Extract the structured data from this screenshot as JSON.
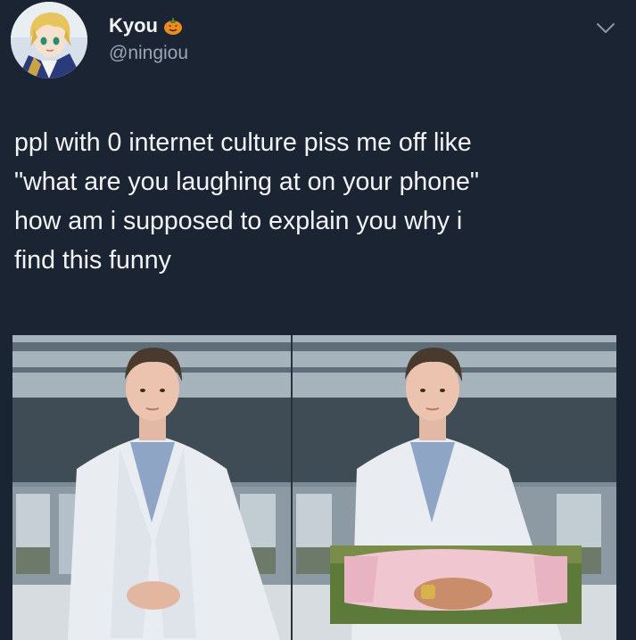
{
  "tweet": {
    "display_name": "Kyou",
    "handle": "@ningiou",
    "text_lines": [
      "ppl with 0 internet culture piss me off like",
      "\"what are you laughing at on your phone\"",
      "how am i supposed to explain you why i",
      "find this funny"
    ]
  },
  "icons": {
    "avatar": "anime-avatar",
    "name_badge": "pumpkin-icon",
    "menu": "chevron-down-icon"
  },
  "colors": {
    "background": "#1b2432",
    "text": "#f3f4f6",
    "handle": "#9aa6b5"
  },
  "media": {
    "panels": [
      "original-photo",
      "edited-photo"
    ]
  }
}
